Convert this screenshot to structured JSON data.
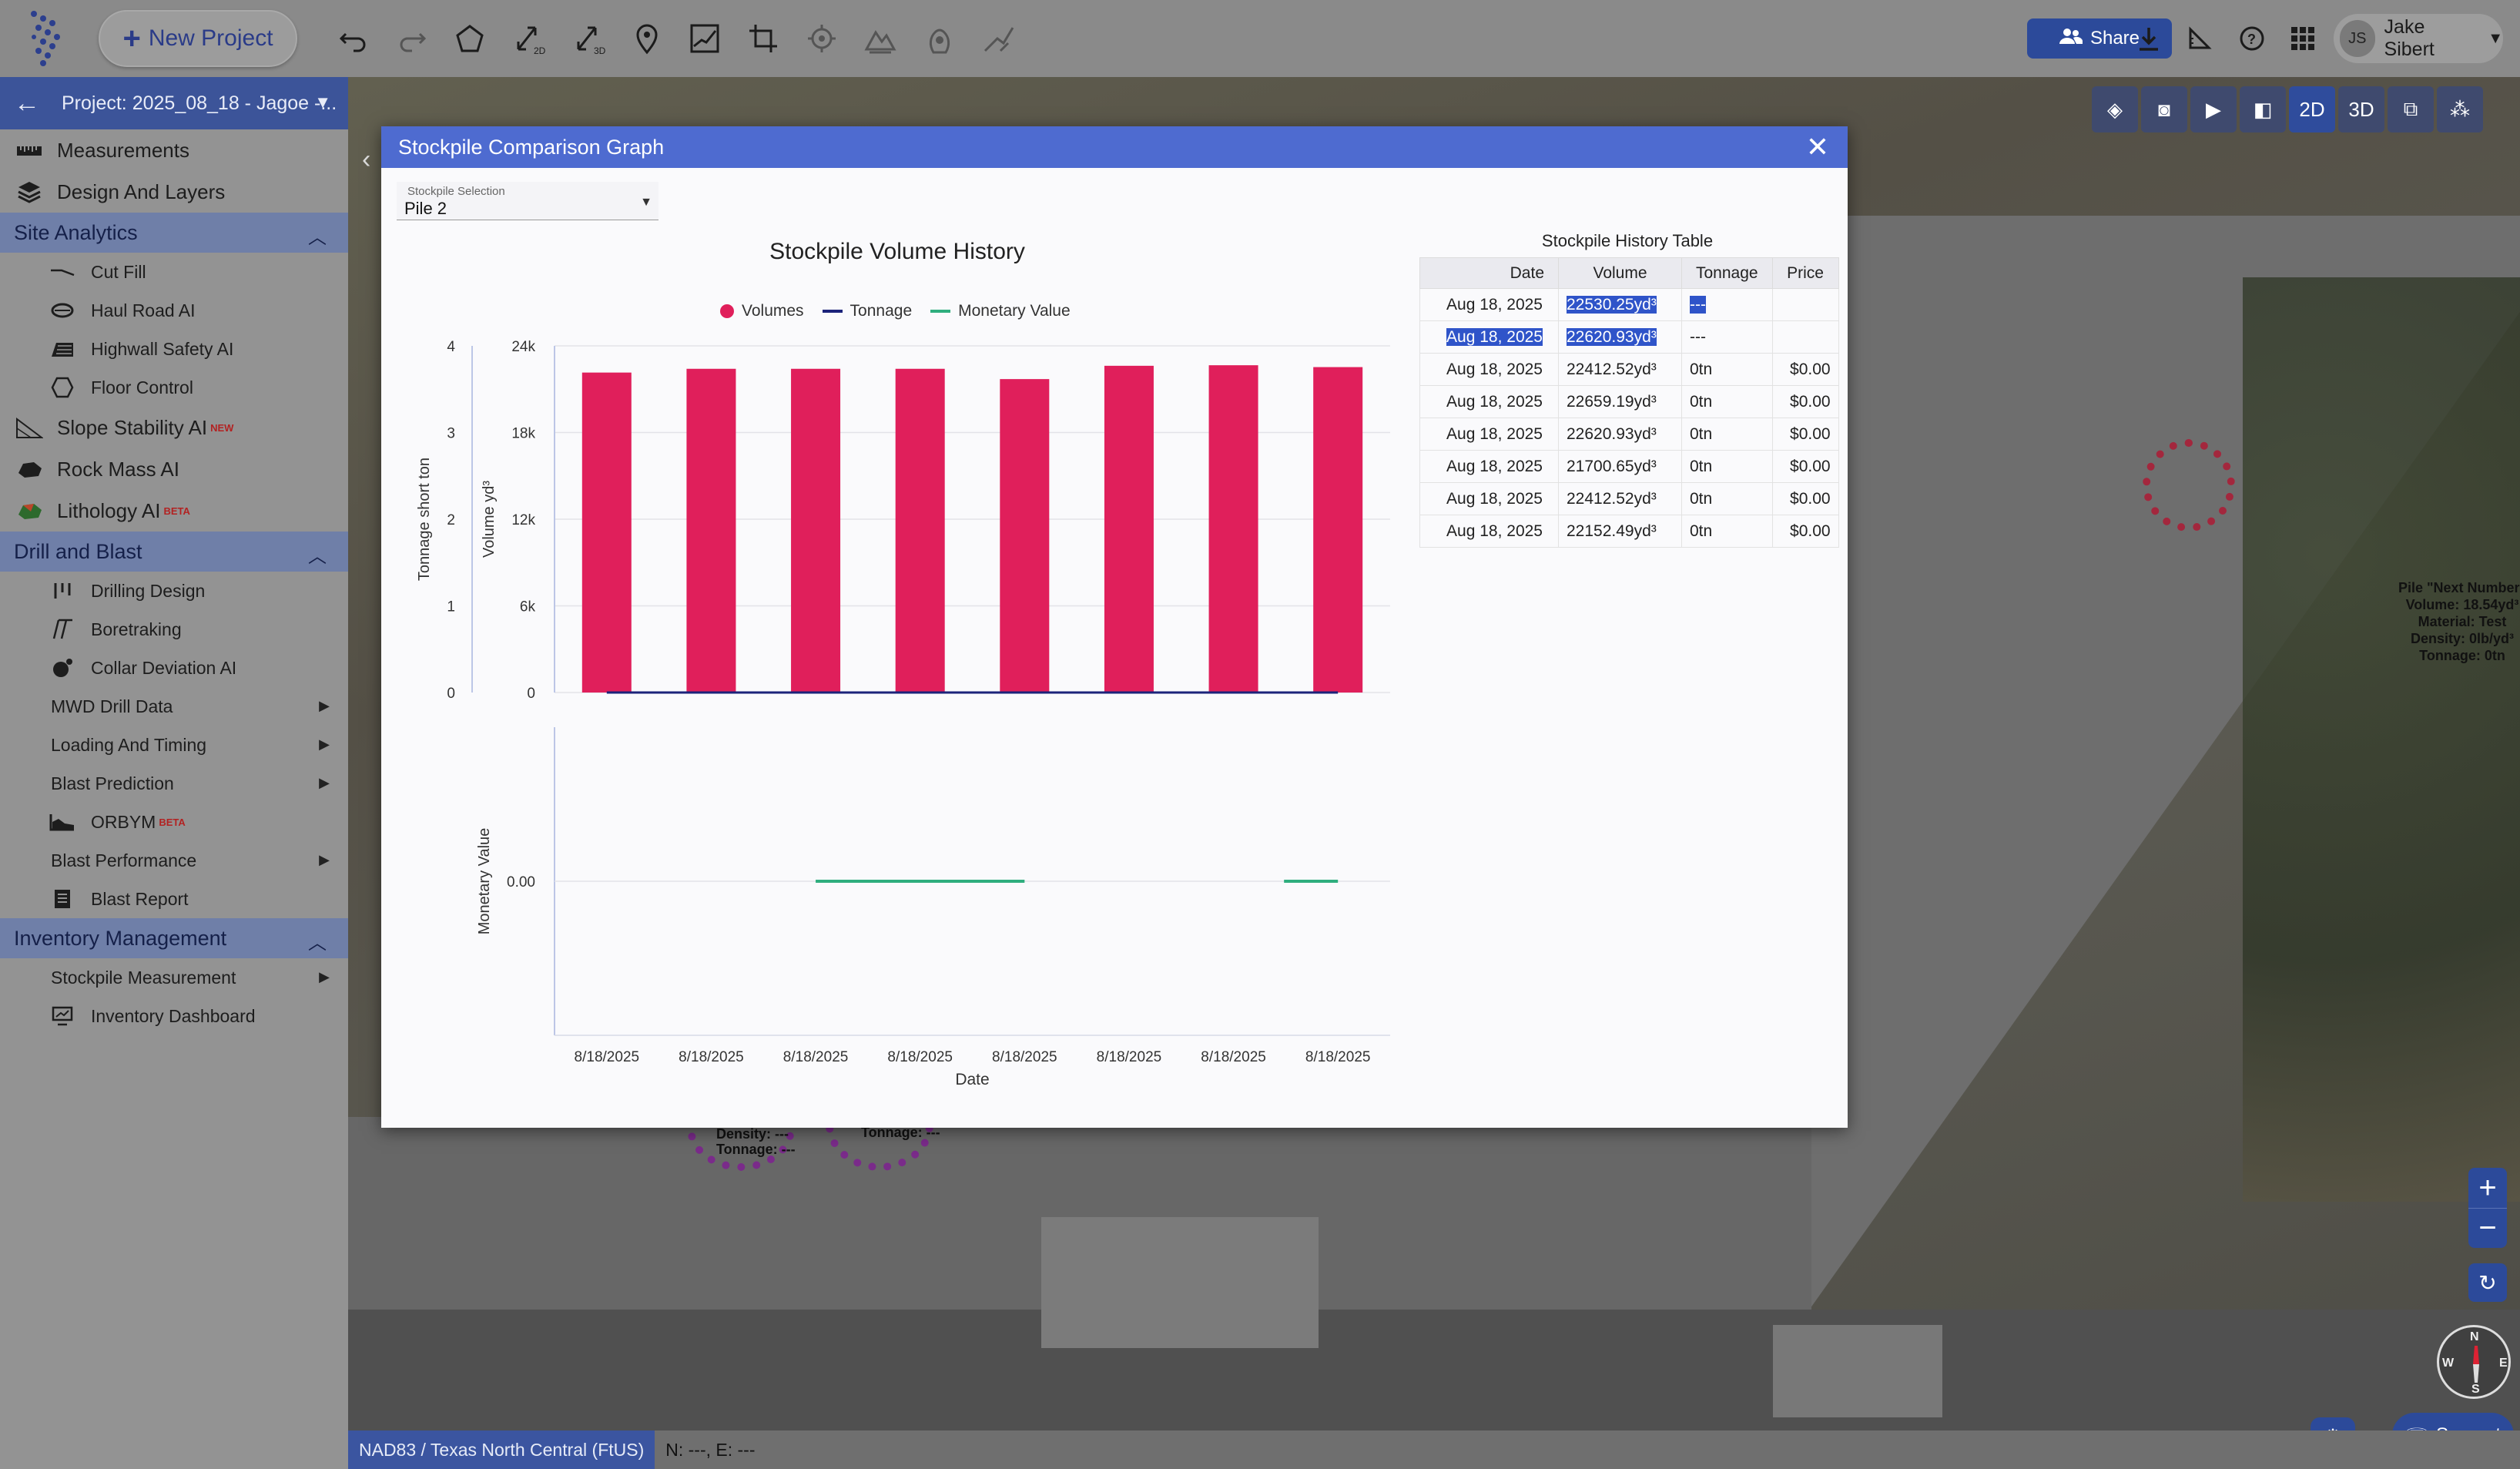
{
  "toolbar": {
    "new_project_label": "New Project",
    "share_label": "Share",
    "user_initials": "JS",
    "user_name": "Jake Sibert",
    "icons": [
      "undo-icon",
      "redo-icon",
      "polygon-icon",
      "measure-2d-icon",
      "measure-3d-icon",
      "location-pin-icon",
      "profile-graph-icon",
      "crop-icon",
      "target-icon",
      "terrain-icon",
      "volume-icon",
      "slope-icon"
    ]
  },
  "sidebar": {
    "project_title": "Project: 2025_08_18 - Jagoe -...",
    "top_items": [
      {
        "label": "Measurements",
        "icon": "ruler-icon"
      },
      {
        "label": "Design And Layers",
        "icon": "layers-icon"
      }
    ],
    "site_analytics": {
      "header": "Site Analytics",
      "items": [
        {
          "label": "Cut Fill",
          "icon": "cut-fill-icon"
        },
        {
          "label": "Haul Road AI",
          "icon": "haul-road-icon"
        },
        {
          "label": "Highwall Safety AI",
          "icon": "highwall-icon"
        },
        {
          "label": "Floor Control",
          "icon": "floor-control-icon"
        }
      ]
    },
    "mid_items": [
      {
        "label": "Slope Stability AI",
        "tag": "NEW",
        "icon": "slope-stability-icon"
      },
      {
        "label": "Rock Mass AI",
        "tag": "",
        "icon": "rock-mass-icon"
      },
      {
        "label": "Lithology AI",
        "tag": "BETA",
        "icon": "lithology-icon"
      }
    ],
    "drill_blast": {
      "header": "Drill and Blast",
      "items": [
        {
          "label": "Drilling Design",
          "icon": "drilling-icon",
          "submenu": false,
          "tag": ""
        },
        {
          "label": "Boretraking",
          "icon": "boretracking-icon",
          "submenu": false,
          "tag": ""
        },
        {
          "label": "Collar Deviation AI",
          "icon": "collar-icon",
          "submenu": false,
          "tag": ""
        },
        {
          "label": "MWD Drill Data",
          "icon": "",
          "submenu": true,
          "tag": ""
        },
        {
          "label": "Loading And Timing",
          "icon": "",
          "submenu": true,
          "tag": ""
        },
        {
          "label": "Blast Prediction",
          "icon": "",
          "submenu": true,
          "tag": ""
        },
        {
          "label": "ORBYM",
          "icon": "orbym-icon",
          "submenu": false,
          "tag": "BETA"
        },
        {
          "label": "Blast Performance",
          "icon": "",
          "submenu": true,
          "tag": ""
        },
        {
          "label": "Blast Report",
          "icon": "report-icon",
          "submenu": false,
          "tag": ""
        }
      ]
    },
    "inventory": {
      "header": "Inventory Management",
      "items": [
        {
          "label": "Stockpile Measurement",
          "icon": "",
          "submenu": true
        },
        {
          "label": "Inventory Dashboard",
          "icon": "dashboard-icon",
          "submenu": false
        }
      ]
    }
  },
  "map": {
    "pile_label": [
      "Pile \"Next Number\"",
      "Volume: 18.54yd³",
      "Material: Test",
      "Density: 0lb/yd³",
      "Tonnage: 0tn"
    ],
    "pile_a_label": [
      "Density: ---",
      "Tonnage: ---"
    ],
    "pile_b_label": [
      "Tonnage: ---"
    ],
    "view_2d": "2D",
    "view_3d": "3D",
    "compass": {
      "n": "N",
      "s": "S",
      "e": "E",
      "w": "W"
    },
    "support_label": "Support"
  },
  "status": {
    "crs": "NAD83 / Texas North Central (FtUS)",
    "coords": "N: ---, E: ---"
  },
  "dialog": {
    "title": "Stockpile Comparison Graph",
    "selection_label": "Stockpile Selection",
    "selection_value": "Pile 2",
    "table_title": "Stockpile History Table",
    "table_headers": [
      "Date",
      "Volume",
      "Tonnage",
      "Price"
    ],
    "table_rows": [
      {
        "date": "Aug 18, 2025",
        "volume": "22530.25yd³",
        "tonnage": "---",
        "price": ""
      },
      {
        "date": "Aug 18, 2025",
        "volume": "22620.93yd³",
        "tonnage": "---",
        "price": ""
      },
      {
        "date": "Aug 18, 2025",
        "volume": "22412.52yd³",
        "tonnage": "0tn",
        "price": "$0.00"
      },
      {
        "date": "Aug 18, 2025",
        "volume": "22659.19yd³",
        "tonnage": "0tn",
        "price": "$0.00"
      },
      {
        "date": "Aug 18, 2025",
        "volume": "22620.93yd³",
        "tonnage": "0tn",
        "price": "$0.00"
      },
      {
        "date": "Aug 18, 2025",
        "volume": "21700.65yd³",
        "tonnage": "0tn",
        "price": "$0.00"
      },
      {
        "date": "Aug 18, 2025",
        "volume": "22412.52yd³",
        "tonnage": "0tn",
        "price": "$0.00"
      },
      {
        "date": "Aug 18, 2025",
        "volume": "22152.49yd³",
        "tonnage": "0tn",
        "price": "$0.00"
      }
    ]
  },
  "chart_data": {
    "type": "bar",
    "title": "Stockpile Volume History",
    "legend": [
      "Volumes",
      "Tonnage",
      "Monetary Value"
    ],
    "colors": {
      "Volumes": "#e01f5b",
      "Tonnage": "#1b237a",
      "Monetary Value": "#2fae7e"
    },
    "categories": [
      "8/18/2025",
      "8/18/2025",
      "8/18/2025",
      "8/18/2025",
      "8/18/2025",
      "8/18/2025",
      "8/18/2025",
      "8/18/2025"
    ],
    "xlabel": "Date",
    "series": [
      {
        "name": "Volumes",
        "type": "bar",
        "axis": "Volume yd³",
        "values": [
          22152.49,
          22412.52,
          22412.52,
          22412.52,
          21700.65,
          22620.93,
          22659.19,
          22530.25
        ]
      },
      {
        "name": "Tonnage",
        "type": "line",
        "axis": "Tonnage short ton",
        "values": [
          0,
          0,
          0,
          0,
          0,
          0,
          0,
          0
        ]
      },
      {
        "name": "Monetary Value",
        "type": "line",
        "axis": "Monetary Value",
        "values": [
          null,
          null,
          0,
          0,
          0,
          null,
          null,
          0
        ]
      }
    ],
    "y_volume": {
      "label": "Volume yd³",
      "ticks": [
        "0",
        "6k",
        "12k",
        "18k",
        "24k"
      ],
      "lim": [
        0,
        24000
      ]
    },
    "y_tonnage": {
      "label": "Tonnage short ton",
      "ticks": [
        "0",
        "1",
        "2",
        "3",
        "4"
      ],
      "lim": [
        0,
        4
      ]
    },
    "y_money": {
      "label": "Monetary Value",
      "ticks": [
        "0.00"
      ]
    }
  }
}
